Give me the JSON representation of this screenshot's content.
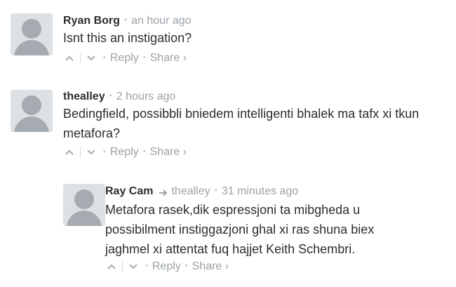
{
  "comments": [
    {
      "author": "Ryan Borg",
      "time": "an hour ago",
      "body": "Isnt this an instigation?",
      "reply_label": "Reply",
      "share_label": "Share ›"
    },
    {
      "author": "thealley",
      "time": "2 hours ago",
      "body": "Bedingfield, possibbli bniedem intelligenti bhalek ma tafx xi tkun metafora?",
      "reply_label": "Reply",
      "share_label": "Share ›"
    },
    {
      "author": "Ray Cam",
      "reply_to": "thealley",
      "time": "31 minutes ago",
      "body": "Metafora rasek,dik espressjoni ta mibgheda u possibilment instiggazjoni ghal xi ras shuna biex jaghmel xi attentat fuq hajjet Keith Schembri.",
      "reply_label": "Reply",
      "share_label": "Share ›"
    }
  ],
  "icons": {
    "upvote": "chevron-up-icon",
    "downvote": "chevron-down-icon",
    "reply_arrow": "reply-arrow-icon"
  },
  "colors": {
    "text": "#2a2e2e",
    "muted": "#9ba2a8",
    "avatar_bg": "#dde1e4",
    "avatar_fg": "#a5abb1"
  }
}
